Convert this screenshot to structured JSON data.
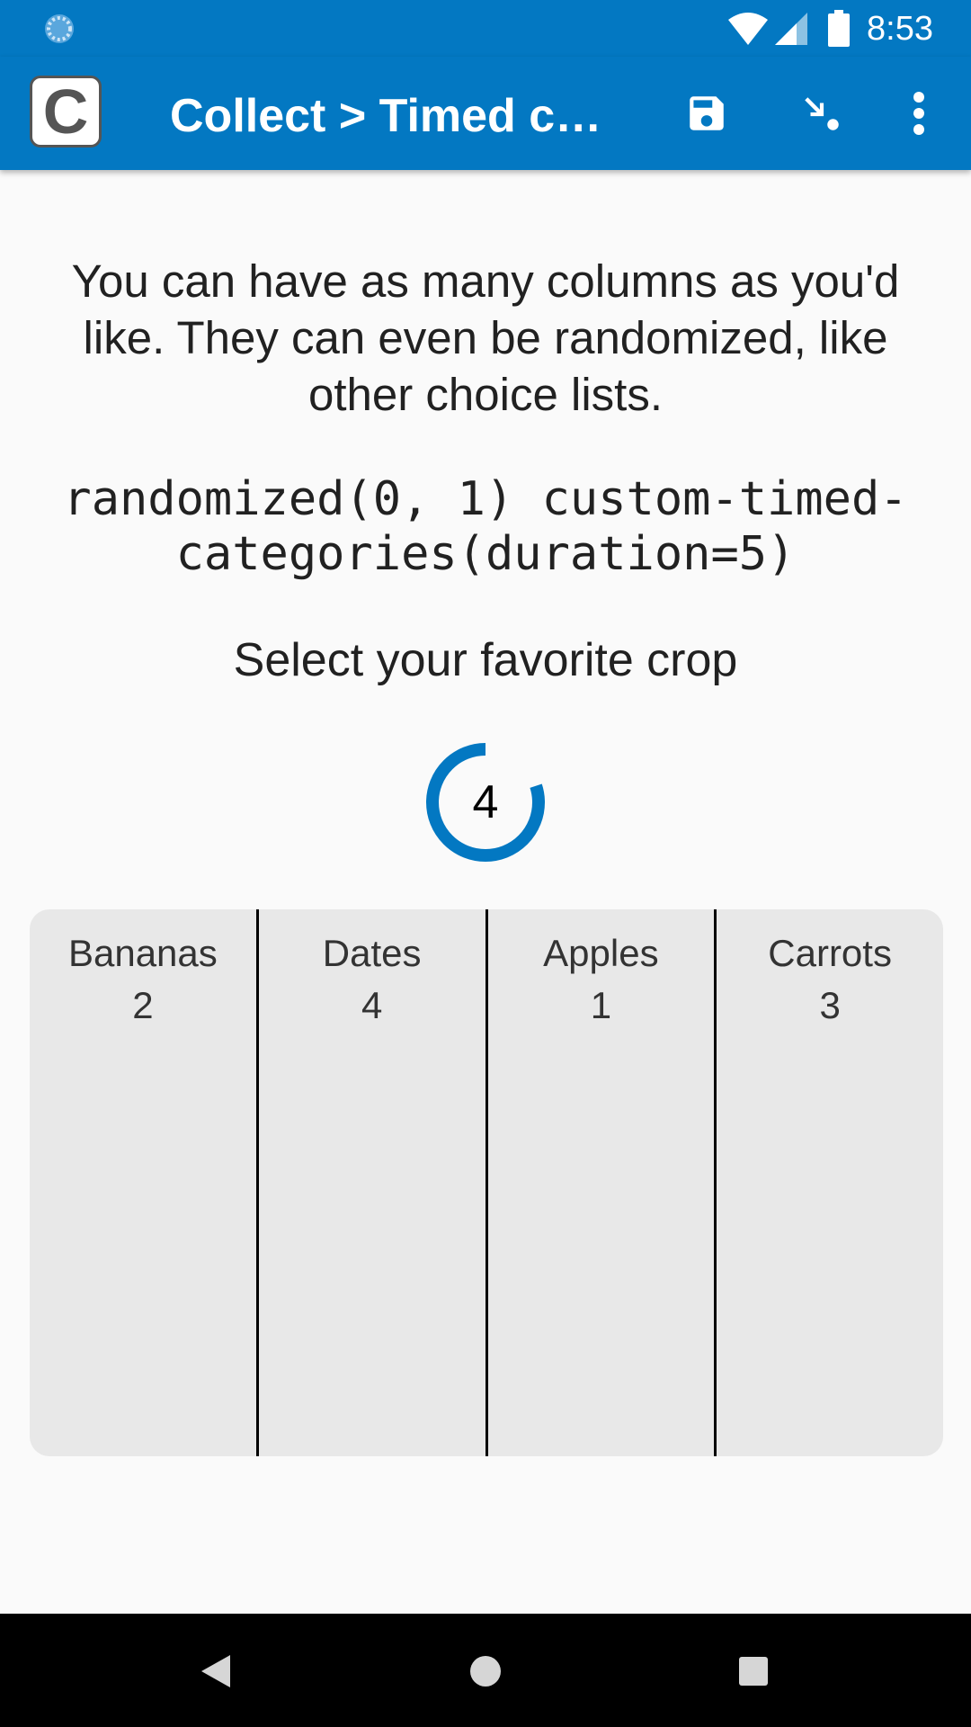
{
  "status_bar": {
    "time": "8:53",
    "icons": [
      "sync-spinner-icon",
      "wifi-icon",
      "cell-signal-icon",
      "battery-icon"
    ]
  },
  "app_bar": {
    "logo_letter": "C",
    "title": "Collect > Timed categories",
    "actions": [
      "save-icon",
      "jump-icon",
      "overflow-menu-icon"
    ],
    "color": "#0378c2"
  },
  "question": {
    "hint": "You can have as many columns as you'd like. They can even be randomized, like other choice lists.",
    "appearance": "randomized(0, 1) custom-timed-categories(duration=5)",
    "label": "Select your favorite crop"
  },
  "timer": {
    "value": "4",
    "remaining_fraction": 0.8,
    "color": "#0378c2"
  },
  "categories": [
    {
      "label": "Bananas",
      "count": "2"
    },
    {
      "label": "Dates",
      "count": "4"
    },
    {
      "label": "Apples",
      "count": "1"
    },
    {
      "label": "Carrots",
      "count": "3"
    }
  ],
  "nav_bar": {
    "buttons": [
      "back-icon",
      "home-icon",
      "recents-icon"
    ]
  }
}
